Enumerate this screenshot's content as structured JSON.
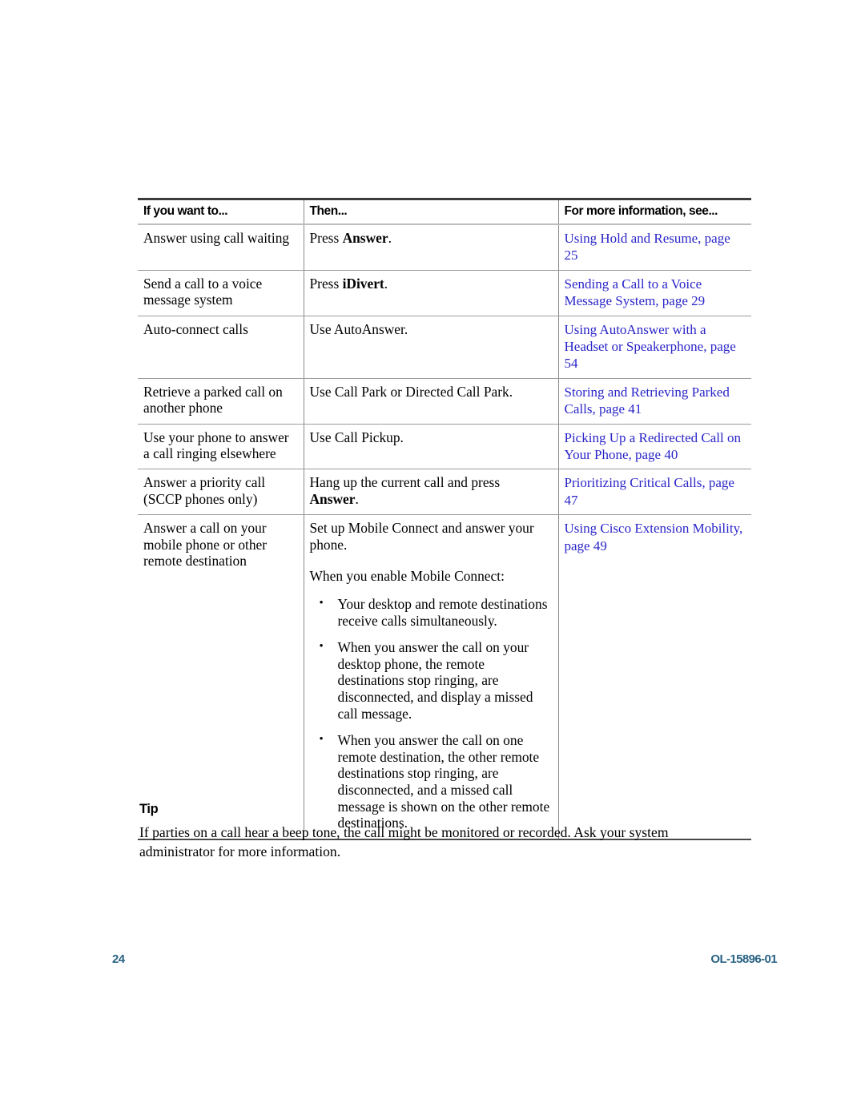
{
  "table": {
    "headers": [
      "If you want to...",
      "Then...",
      "For more information, see..."
    ],
    "rows": [
      {
        "want": "Answer using call waiting",
        "then_pre": "Press ",
        "then_bold": "Answer",
        "then_post": ".",
        "xref": "Using Hold and Resume, page 25"
      },
      {
        "want": "Send a call to a voice message system",
        "then_pre": "Press ",
        "then_bold": "iDivert",
        "then_post": ".",
        "xref": "Sending a Call to a Voice Message System, page 29"
      },
      {
        "want": "Auto-connect calls",
        "then_pre": "Use AutoAnswer.",
        "then_bold": "",
        "then_post": "",
        "xref": "Using AutoAnswer with a Headset or Speakerphone, page 54"
      },
      {
        "want": "Retrieve a parked call on another phone",
        "then_pre": "Use Call Park or Directed Call Park.",
        "then_bold": "",
        "then_post": "",
        "xref": "Storing and Retrieving Parked Calls, page 41"
      },
      {
        "want": "Use your phone to answer a call ringing elsewhere",
        "then_pre": "Use Call Pickup.",
        "then_bold": "",
        "then_post": "",
        "xref": "Picking Up a Redirected Call on Your Phone, page 40"
      },
      {
        "want": "Answer a priority call (SCCP phones only)",
        "then_pre": "Hang up the current call and press ",
        "then_bold": "Answer",
        "then_post": ".",
        "xref": "Prioritizing Critical Calls, page 47"
      }
    ],
    "mobile_row": {
      "want": "Answer a call on your mobile phone or other remote destination",
      "then_line1": "Set up Mobile Connect and answer your phone.",
      "then_line2": "When you enable Mobile Connect:",
      "bullet_marker": "•",
      "bullets": [
        "Your desktop and remote destinations receive calls simultaneously.",
        "When you answer the call on your desktop phone, the remote destinations stop ringing, are disconnected, and display a missed call message.",
        "When you answer the call on one remote destination, the other remote destinations stop ringing, are disconnected, and a missed call message is shown on the other remote destinations."
      ],
      "xref": "Using Cisco Extension Mobility, page 49"
    }
  },
  "tip": {
    "heading": "Tip",
    "body": "If parties on a call hear a beep tone, the call might be monitored or recorded. Ask your system administrator for more information."
  },
  "footer": {
    "page_number": "24",
    "doc_id": "OL-15896-01"
  },
  "colors": {
    "xref_link": "#2a25c8",
    "footer": "#2a6384",
    "rule_dark": "#3b3b3b",
    "rule_light": "#9b9b9b"
  }
}
